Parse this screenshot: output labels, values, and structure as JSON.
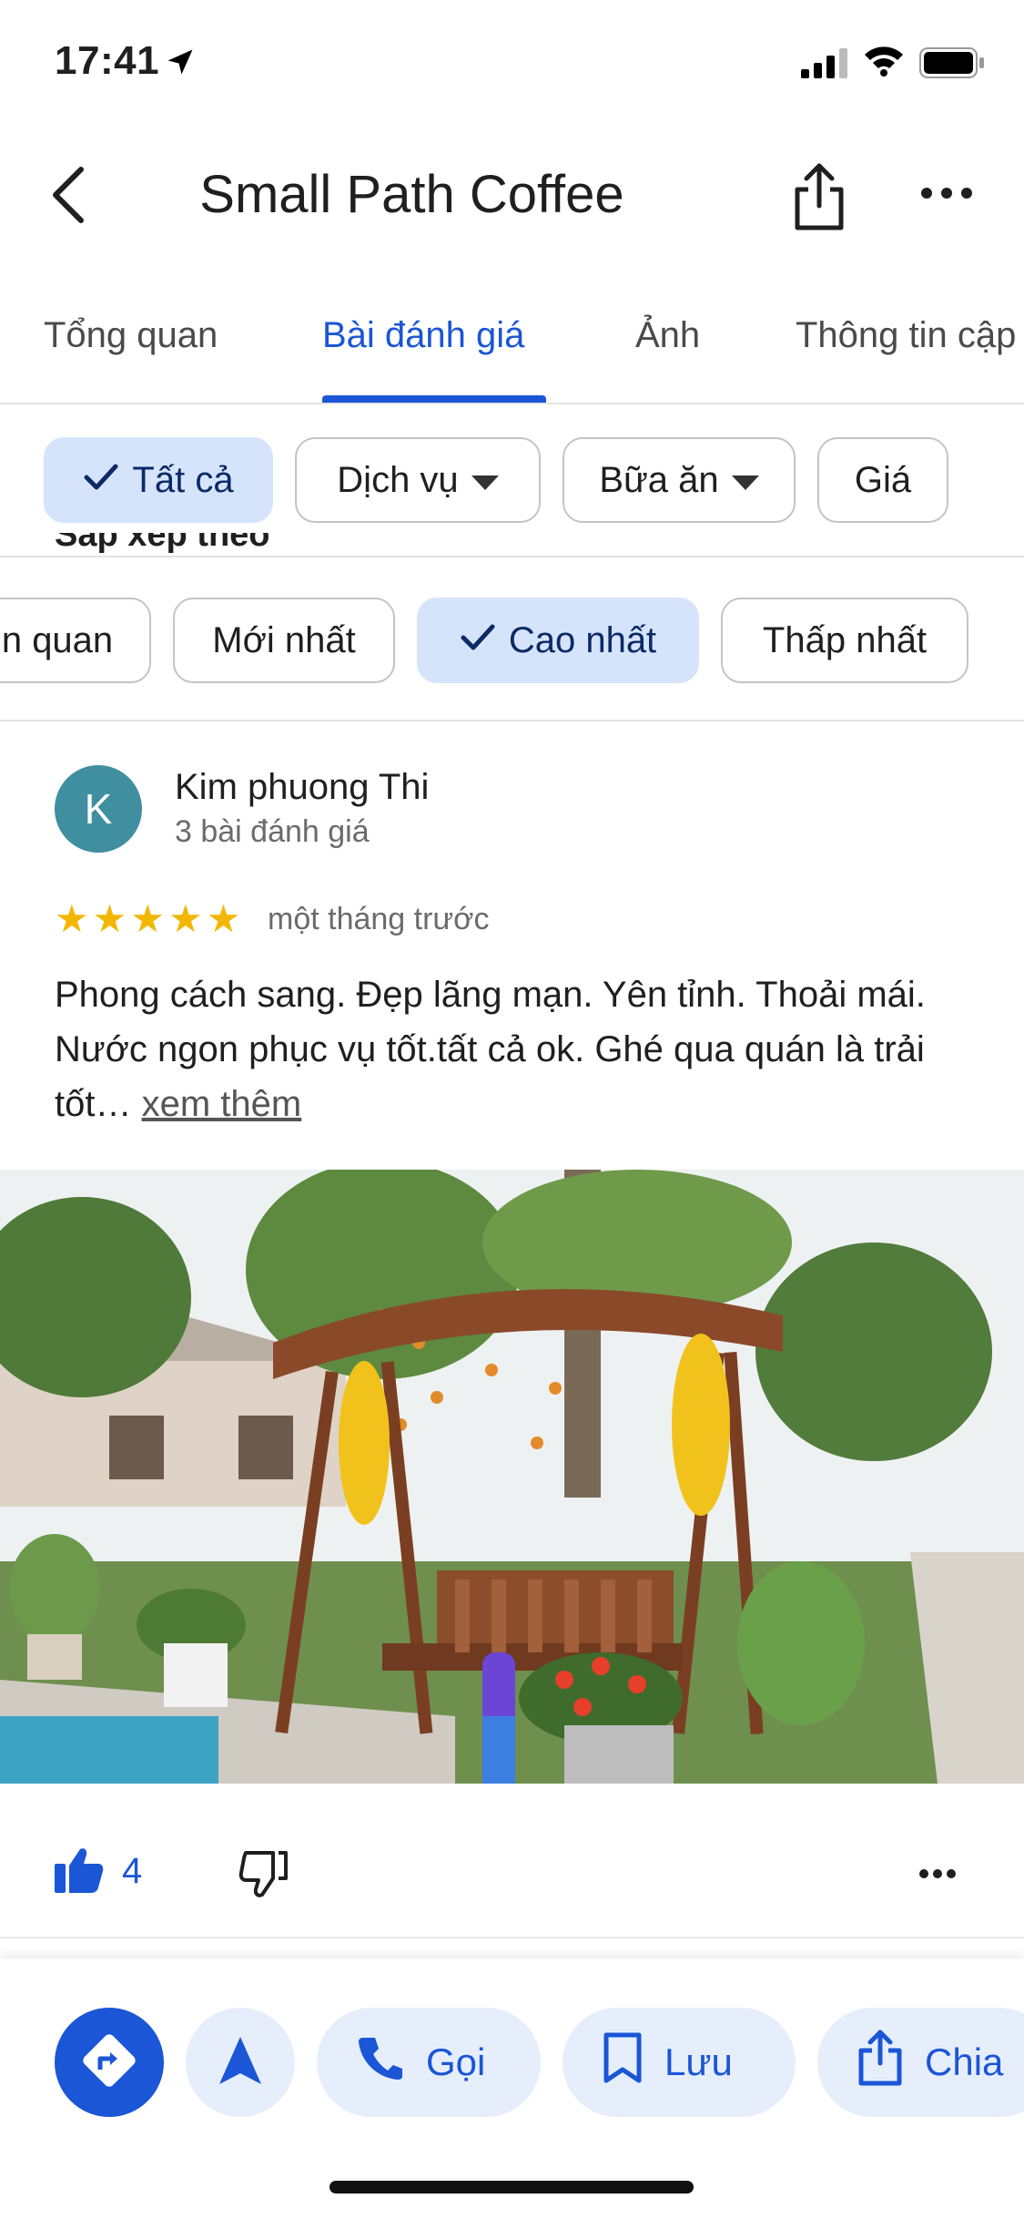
{
  "status_bar": {
    "time": "17:41"
  },
  "header": {
    "title": "Small Path Coffee"
  },
  "tabs": [
    {
      "label": "Tổng quan"
    },
    {
      "label": "Bài đánh giá"
    },
    {
      "label": "Ảnh"
    },
    {
      "label": "Thông tin cập"
    }
  ],
  "filters": [
    {
      "label": "Tất cả",
      "selected": true
    },
    {
      "label": "Dịch vụ",
      "dropdown": true
    },
    {
      "label": "Bữa ăn",
      "dropdown": true
    },
    {
      "label": "Giá"
    }
  ],
  "sort": {
    "label": "Sắp xếp theo",
    "options": [
      {
        "label": "n quan"
      },
      {
        "label": "Mới nhất"
      },
      {
        "label": "Cao nhất",
        "selected": true
      },
      {
        "label": "Thấp nhất"
      }
    ]
  },
  "review": {
    "avatar_letter": "K",
    "avatar_color": "#3f8fa0",
    "name": "Kim phuong Thi",
    "count": "3 bài đánh giá",
    "rating": 5,
    "time": "một tháng trước",
    "text": "Phong cách sang. Đẹp lãng mạn. Yên tỉnh. Thoải mái. Nước ngon phục vụ tốt.tất cả ok. Ghé qua quán là trải tốt…",
    "more": "xem thêm",
    "likes": "4"
  },
  "actions": {
    "call": "Gọi",
    "save": "Lưu",
    "share": "Chia"
  },
  "colors": {
    "accent": "#1a56d6",
    "chip_selected": "#d6e4fb",
    "star": "#f2b705"
  }
}
